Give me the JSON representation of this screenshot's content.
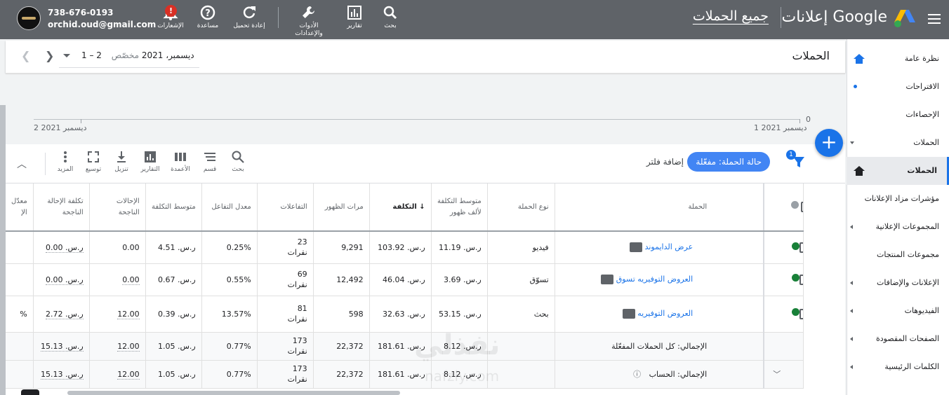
{
  "topbar": {
    "brand": "إعلانات Google",
    "account": "جميع الحملات",
    "email": "orchid.oud@gmail.com",
    "phone": "738-676-0193",
    "tools": [
      {
        "label": "بحث",
        "icon": "search-icon"
      },
      {
        "label": "تقارير",
        "icon": "bar-chart-icon"
      },
      {
        "label": "الأدوات والإعدادات",
        "icon": "wrench-icon"
      },
      {
        "label": "إعادة تحميل",
        "icon": "refresh-icon"
      },
      {
        "label": "مساعدة",
        "icon": "help-icon"
      },
      {
        "label": "الإشعارات",
        "icon": "bell-icon",
        "badge": "!"
      }
    ]
  },
  "sidebar": {
    "items": [
      {
        "label": "نظرة عامة",
        "icon": "home-icon"
      },
      {
        "label": "الاقتراحات",
        "icon": "dot-icon"
      },
      {
        "label": "الإحصاءات"
      },
      {
        "label": "الحملات",
        "icon": "chevron-down-icon"
      },
      {
        "label": "الحملات",
        "icon": "home-icon",
        "active": true
      },
      {
        "label": "مؤشرات مزاد الإعلانات"
      },
      {
        "label": "المجموعات الإعلانية",
        "icon": "chevron-left-icon"
      },
      {
        "label": "مجموعات المنتجات"
      },
      {
        "label": "الإعلانات والإضافات",
        "icon": "chevron-left-icon"
      },
      {
        "label": "الفيديوهات",
        "icon": "chevron-left-icon"
      },
      {
        "label": "الصفحات المقصودة",
        "icon": "chevron-left-icon"
      },
      {
        "label": "الكلمات الرئيسية",
        "icon": "chevron-left-icon"
      }
    ]
  },
  "header": {
    "title": "الحملات",
    "date_type": "مخصّص",
    "date_range": "1 – 2 ديسمبر، 2021"
  },
  "chart": {
    "zero_label": "0",
    "start_date": "1 ديسمبر 2021",
    "end_date": "2 ديسمبر 2021"
  },
  "filters": {
    "count": "1",
    "chip": "حالة الحملة: مفعّلة",
    "add_filter": "إضافة فلتر"
  },
  "table_tools": [
    {
      "label": "بحث",
      "icon": "search-icon"
    },
    {
      "label": "قسم",
      "icon": "segment-icon"
    },
    {
      "label": "الأعمدة",
      "icon": "columns-icon"
    },
    {
      "label": "التقارير",
      "icon": "report-icon"
    },
    {
      "label": "تنزيل",
      "icon": "download-icon"
    },
    {
      "label": "توسيع",
      "icon": "expand-icon"
    },
    {
      "label": "المزيد",
      "icon": "more-icon"
    }
  ],
  "table": {
    "headers": {
      "campaign": "الحملة",
      "type": "نوع الحملة",
      "avg_cpm": "متوسط التكلفة لألف ظهور",
      "cost": "التكلفة",
      "impressions": "مرات الظهور",
      "interactions": "التفاعلات",
      "interaction_rate": "معدل التفاعل",
      "avg_cost": "متوسط التكلفة",
      "conversions": "الإحالات الناجحة",
      "cost_per_conv": "تكلفة الإحالة الناجحة",
      "conv_rate": "معدّل الإ"
    },
    "rows": [
      {
        "name": "عرض الدايموند",
        "type": "فيديو",
        "avg_cpm": "ر.س. 11.19",
        "cost": "ر.س. 103.92",
        "impressions": "9,291",
        "interactions": "23",
        "interactions_unit": "نقرات",
        "interaction_rate": "0.25%",
        "avg_cost": "ر.س. 4.51",
        "conversions": "0.00",
        "cost_per_conv": "ر.س. 0.00",
        "conv_rate": ""
      },
      {
        "name": "العروض التوفيريه تسوق",
        "type": "تسوّق",
        "avg_cpm": "ر.س. 3.69",
        "cost": "ر.س. 46.04",
        "impressions": "12,492",
        "interactions": "69",
        "interactions_unit": "نقرات",
        "interaction_rate": "0.55%",
        "avg_cost": "ر.س. 0.67",
        "conversions": "0.00",
        "cost_per_conv": "ر.س. 0.00",
        "conv_rate": ""
      },
      {
        "name": "العروض التوفيريه",
        "type": "بحث",
        "avg_cpm": "ر.س. 53.15",
        "cost": "ر.س. 32.63",
        "impressions": "598",
        "interactions": "81",
        "interactions_unit": "نقرات",
        "interaction_rate": "13.57%",
        "avg_cost": "ر.س. 0.39",
        "conversions": "12.00",
        "cost_per_conv": "ر.س. 2.72",
        "conv_rate": "%"
      }
    ],
    "totals": [
      {
        "label": "الإجمالي: كل الحملات المفعّلة",
        "avg_cpm": "ر.س. 8.12",
        "cost": "ر.س. 181.61",
        "impressions": "22,372",
        "interactions": "173",
        "interactions_unit": "نقرات",
        "interaction_rate": "0.77%",
        "avg_cost": "ر.س. 1.05",
        "conversions": "12.00",
        "cost_per_conv": "ر.س. 15.13"
      },
      {
        "label": "الإجمالي: الحساب",
        "avg_cpm": "ر.س. 8.12",
        "cost": "ر.س. 181.61",
        "impressions": "22,372",
        "interactions": "173",
        "interactions_unit": "نقرات",
        "interaction_rate": "0.77%",
        "avg_cost": "ر.س. 1.05",
        "conversions": "12.00",
        "cost_per_conv": "ر.س. 15.13"
      }
    ]
  },
  "watermark": {
    "arabic": "نفذلي",
    "latin": "nafzly.com"
  },
  "colors": {
    "accent": "#1a73e8",
    "topbar": "#5f6368",
    "enabled": "#188038",
    "alert": "#d93025"
  }
}
